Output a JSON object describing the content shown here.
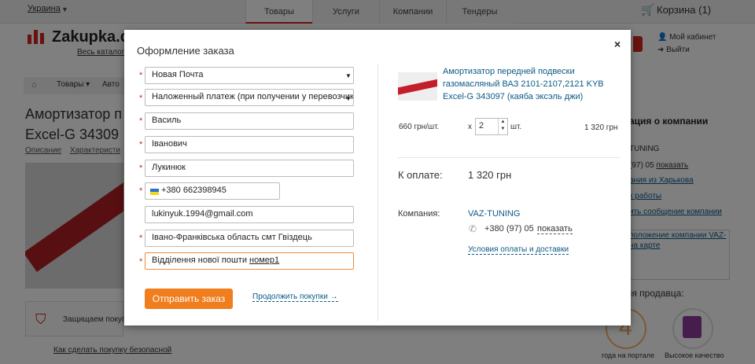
{
  "topbar": {
    "region": "Украина",
    "tabs": [
      "Товары",
      "Услуги",
      "Компании",
      "Тендеры"
    ],
    "cart": "Корзина (1)"
  },
  "header": {
    "logo": "Zakupka.c",
    "catalog_link": "Весь каталог",
    "cabinet": "Мой кабинет",
    "logout": "Выйти"
  },
  "page": {
    "breadcrumb_goods": "Товары",
    "breadcrumb_auto": "Авто",
    "title_line1": "Амортизатор п",
    "title_line2": "Excel-G 34309",
    "tab_description": "Описание",
    "tab_specs": "Характеристи",
    "protect_text": "Защищаем покуп",
    "safe_link": "Как сделать покупку безопасной"
  },
  "sidebar": {
    "title": "ация о компании",
    "company": "TUNING",
    "phone": "(97) 05",
    "show": "показать",
    "city": "ания из Харькова",
    "hours": "к работы",
    "message": "ить сообщение компании",
    "map_line1": "положение компании VAZ-",
    "map_line2": "на карте",
    "seller_title": "ния продавца:",
    "badge_years": "4",
    "badge_caption1": "года на портале",
    "badge_caption2": "Высокое качество"
  },
  "modal": {
    "title": "Оформление заказа",
    "close": "×",
    "fields": {
      "delivery": "Новая Почта",
      "payment": "Наложенный платеж (при получении у перевозчика)",
      "first_name": "Василь",
      "middle_name": "Іванович",
      "last_name": "Лукинюк",
      "phone": "+380 662398945",
      "email": "lukinyuk.1994@gmail.com",
      "city": "Івано-Франківська область  смт Гвіздець",
      "address_prefix": "Відділення нової пошти ",
      "address_suffix": "номер1"
    },
    "submit": "Отправить заказ",
    "continue": "Продолжить покупки →",
    "product": {
      "name": "Амортизатор передней подвески газомасляный ВАЗ 2101-2107,2121 KYB Excel-G 343097 (каяба эксэль джи)",
      "price": "660 грн/шт.",
      "x": "x",
      "quantity": "2",
      "unit": "шт.",
      "total": "1 320 грн"
    },
    "pay_label": "К оплате:",
    "pay_value": "1 320 грн",
    "company_label": "Компания:",
    "company_name": "VAZ-TUNING",
    "company_phone": "+380 (97) 05",
    "show_phone": "показать",
    "terms": "Условия оплаты и доставки"
  },
  "colors": {
    "brand_red": "#d3261e",
    "submit_orange": "#f07d1e",
    "link_blue": "#0a5a85"
  }
}
